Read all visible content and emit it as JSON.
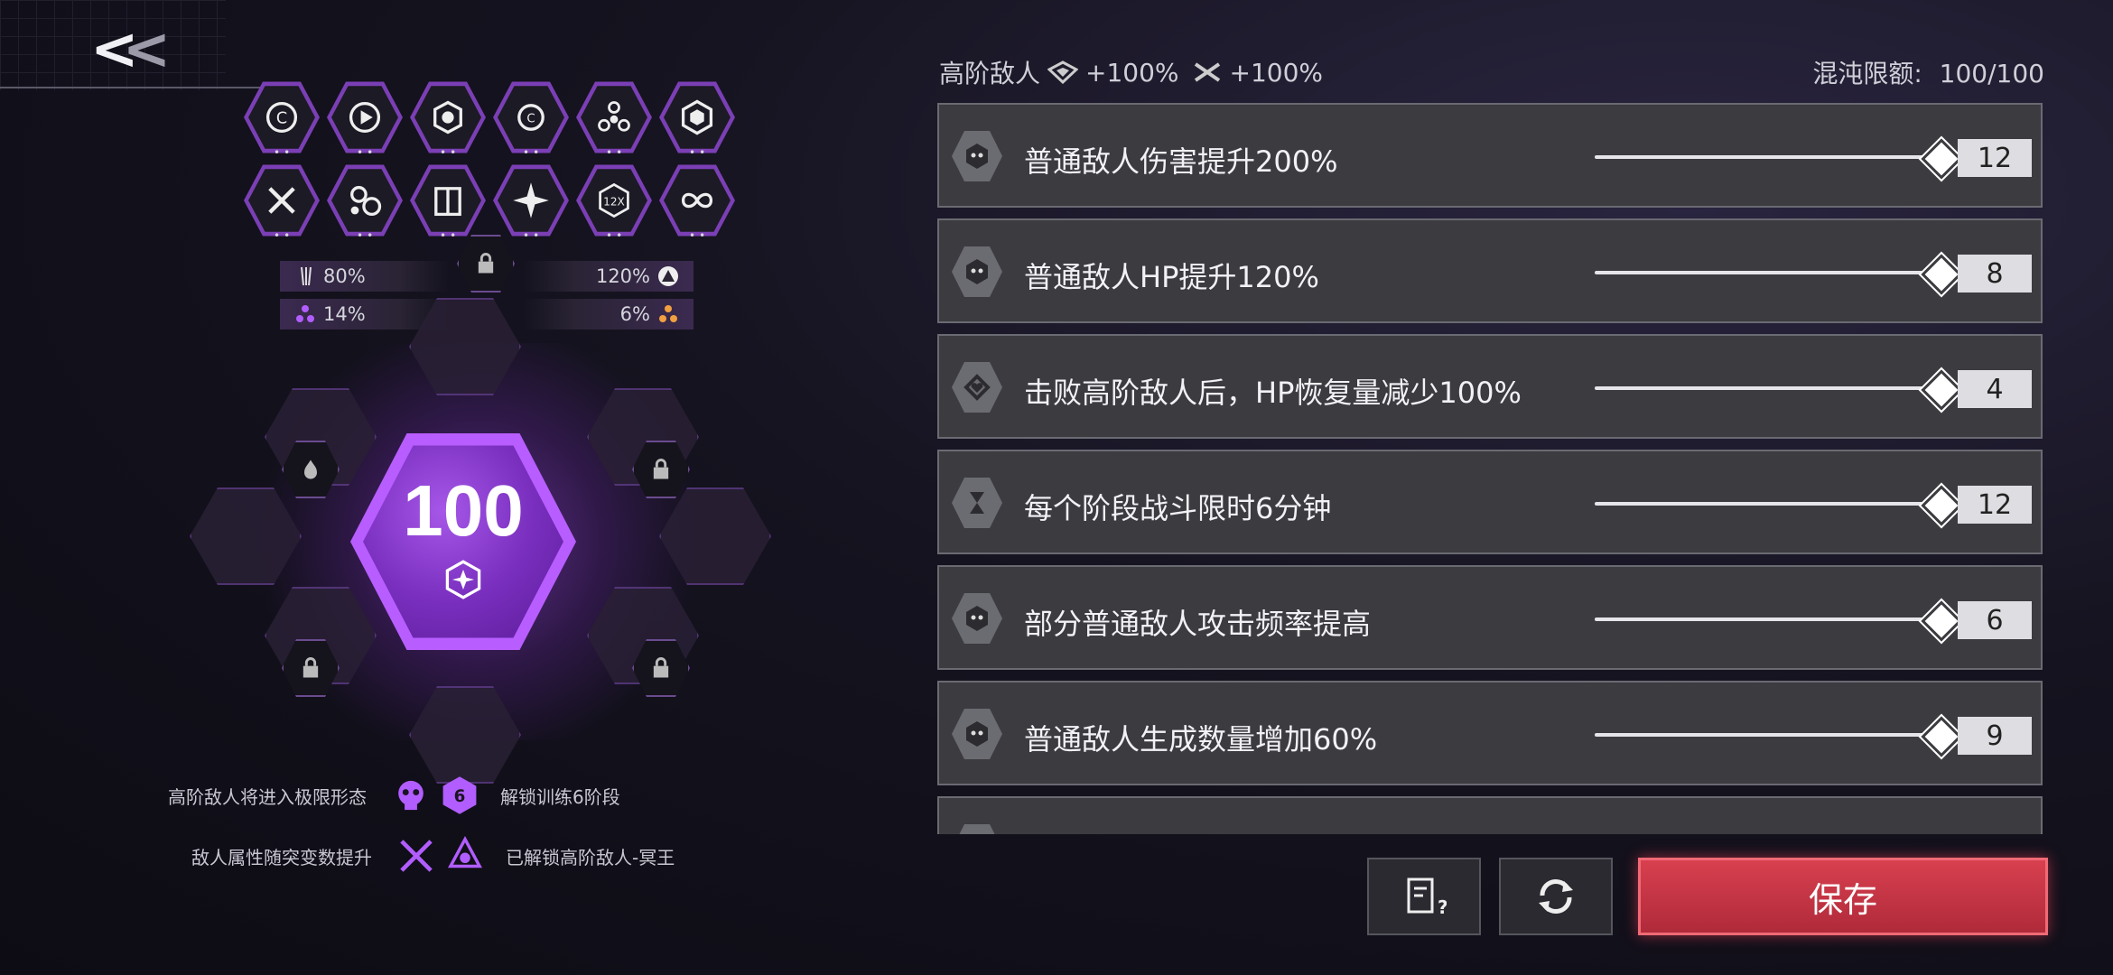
{
  "nav": {
    "back_label": "<<"
  },
  "icon_grid": [
    {
      "name": "c-ring-icon"
    },
    {
      "name": "play-badge-icon"
    },
    {
      "name": "gear-hex-icon"
    },
    {
      "name": "refresh-c-icon"
    },
    {
      "name": "tri-orb-icon"
    },
    {
      "name": "shield-hex-icon"
    },
    {
      "name": "crossed-swords-icon"
    },
    {
      "name": "gears-icon"
    },
    {
      "name": "cube-book-icon"
    },
    {
      "name": "star-burst-icon"
    },
    {
      "name": "twelve-x-icon"
    },
    {
      "name": "infinity-icon"
    }
  ],
  "stats": {
    "top_left": "80%",
    "top_right": "120%",
    "bottom_left": "14%",
    "bottom_right": "6%"
  },
  "center": {
    "value": "100"
  },
  "bottom_info": {
    "left1": "高阶敌人将进入极限形态",
    "right1": "解锁训练6阶段",
    "left2": "敌人属性随突变数提升",
    "right2": "已解锁高阶敌人-冥王",
    "stage_badge": "6"
  },
  "header": {
    "title": "高阶敌人",
    "defense_bonus": "+100%",
    "attack_bonus": "+100%",
    "limit_label": "混沌限额:",
    "limit_value": "100/100"
  },
  "modifiers": [
    {
      "label": "普通敌人伤害提升200%",
      "value": "12",
      "level": 1.0
    },
    {
      "label": "普通敌人HP提升120%",
      "value": "8",
      "level": 1.0
    },
    {
      "label": "击败高阶敌人后，HP恢复量减少100%",
      "value": "4",
      "level": 1.0
    },
    {
      "label": "每个阶段战斗限时6分钟",
      "value": "12",
      "level": 1.0
    },
    {
      "label": "部分普通敌人攻击频率提高",
      "value": "6",
      "level": 1.0
    },
    {
      "label": "普通敌人生成数量增加60%",
      "value": "9",
      "level": 1.0
    }
  ],
  "buttons": {
    "save": "保存"
  },
  "colors": {
    "accent_purple": "#b85dff",
    "save_red": "#c8323f",
    "row_bg": "#3b3b40"
  }
}
